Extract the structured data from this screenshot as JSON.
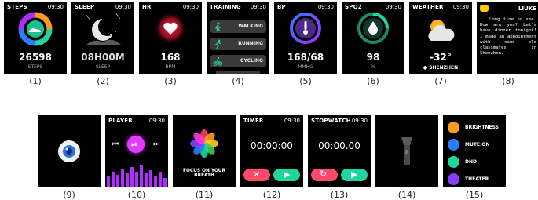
{
  "screens": {
    "s1": {
      "title": "STEPS",
      "time": "09:30",
      "value": "26598",
      "unit": "STEPS",
      "caption": "(1)"
    },
    "s2": {
      "title": "SLEEP",
      "time": "09:30",
      "value": "08H00M",
      "unit": "SLEEP",
      "caption": "(2)"
    },
    "s3": {
      "title": "HR",
      "time": "09:30",
      "value": "168",
      "unit": "BPM",
      "caption": "(3)"
    },
    "s4": {
      "title": "TRAINING",
      "time": "09:30",
      "items": [
        "WALKING",
        "RUNNING",
        "CYCLING"
      ],
      "caption": "(4)"
    },
    "s5": {
      "title": "BP",
      "time": "09:30",
      "value": "168/68",
      "unit": "MMHG",
      "caption": "(5)"
    },
    "s6": {
      "title": "SPO2",
      "time": "09:30",
      "value": "98",
      "unit": "%",
      "caption": "(6)"
    },
    "s7": {
      "title": "WEATHER",
      "time": "09:30",
      "value": "-32°",
      "location": "SHENZHEN",
      "caption": "(7)"
    },
    "s8": {
      "sender": "LIUKE",
      "message": "Long time no see. How are you? Let's have dinner tonight! I made an appointment with some old classmates in Shenzhen.",
      "caption": "(8)"
    },
    "s9": {
      "caption": "(9)"
    },
    "s10": {
      "title": "PLAYER",
      "time": "09:30",
      "caption": "(10)"
    },
    "s11": {
      "text": "FOCUS ON YOUR BREATH",
      "caption": "(11)"
    },
    "s12": {
      "title": "TIMER",
      "time": "09:30",
      "value": "00:00:00",
      "caption": "(12)"
    },
    "s13": {
      "title": "STOPWATCH",
      "time": "09:30",
      "value": "00:00.00",
      "caption": "(13)"
    },
    "s14": {
      "caption": "(14)"
    },
    "s15": {
      "items": [
        "BRIGHTNESS",
        "MUTE:ON",
        "DND",
        "THEATER"
      ],
      "caption": "(15)"
    }
  },
  "colors": {
    "accent_green": "#1fd6a0",
    "accent_red": "#ff4a6a",
    "hr_red": "#ff2a3c",
    "purple": "#8a3dff"
  }
}
